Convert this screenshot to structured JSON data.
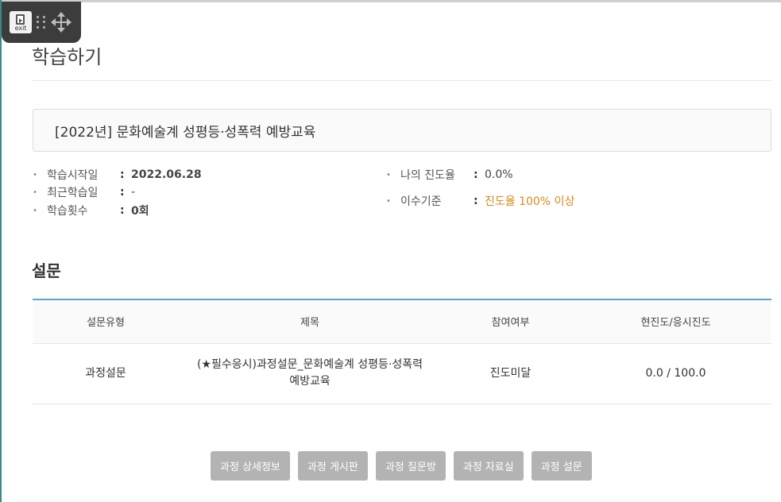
{
  "toolbar": {
    "exit_label": "exit"
  },
  "page": {
    "title": "학습하기"
  },
  "course": {
    "title": "[2022년] 문화예술계 성평등·성폭력 예방교육"
  },
  "info_left": [
    {
      "label": "학습시작일",
      "value": "2022.06.28"
    },
    {
      "label": "최근학습일",
      "value": "-"
    },
    {
      "label": "학습횟수",
      "value": "0회"
    }
  ],
  "info_right": [
    {
      "label": "나의 진도율",
      "value": "0.0%"
    },
    {
      "label": "이수기준",
      "value": "진도율 100% 이상"
    }
  ],
  "colors": {
    "accent": "#d98a1c",
    "table_border": "#5aa9c8",
    "button_bg": "#b3b3b3"
  },
  "survey": {
    "title": "설문",
    "columns": [
      "설문유형",
      "제목",
      "참여여부",
      "현진도/응시진도"
    ],
    "rows": [
      {
        "type": "과정설문",
        "title_line1": "(★필수응시)과정설문_문화예술계 성평등·성폭력",
        "title_line2": "예방교육",
        "status": "진도미달",
        "progress": "0.0 / 100.0"
      }
    ]
  },
  "buttons": [
    "과정 상세정보",
    "과정 게시판",
    "과정 질문방",
    "과정 자료실",
    "과정 설문"
  ]
}
